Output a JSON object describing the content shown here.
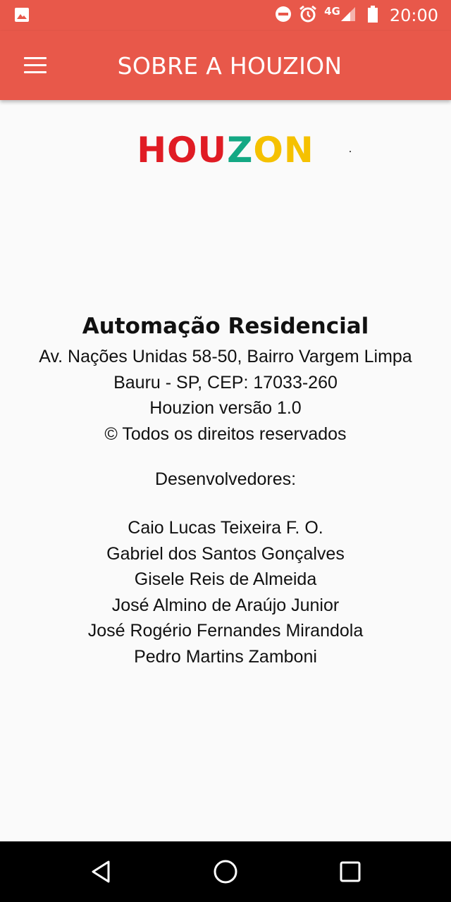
{
  "status_bar": {
    "network": "4G",
    "time": "20:00"
  },
  "app_bar": {
    "title": "SOBRE A HOUZION"
  },
  "logo": {
    "part1": "HOU",
    "part2": "Z",
    "part3": "ON"
  },
  "about": {
    "heading": "Automação Residencial",
    "address_line1": "Av. Nações Unidas 58-50, Bairro Vargem Limpa",
    "address_line2": "Bauru - SP, CEP: 17033-260",
    "version": "Houzion versão 1.0",
    "copyright": "© Todos os direitos reservados",
    "developers_label": "Desenvolvedores:",
    "developers": [
      "Caio Lucas Teixeira F. O.",
      "Gabriel dos Santos Gonçalves",
      "Gisele Reis de Almeida",
      "José Almino de Araújo Junior",
      "José Rogério Fernandes Mirandola",
      "Pedro Martins Zamboni"
    ]
  },
  "colors": {
    "primary": "#e8584a",
    "logo_red": "#e01c24",
    "logo_green": "#14a884",
    "logo_yellow": "#f5c100"
  },
  "icons": {
    "status_left": "image-notification-icon",
    "status_right": [
      "do-not-disturb-icon",
      "alarm-icon",
      "signal-icon",
      "battery-icon"
    ],
    "nav": [
      "back-icon",
      "home-icon",
      "recents-icon"
    ]
  }
}
